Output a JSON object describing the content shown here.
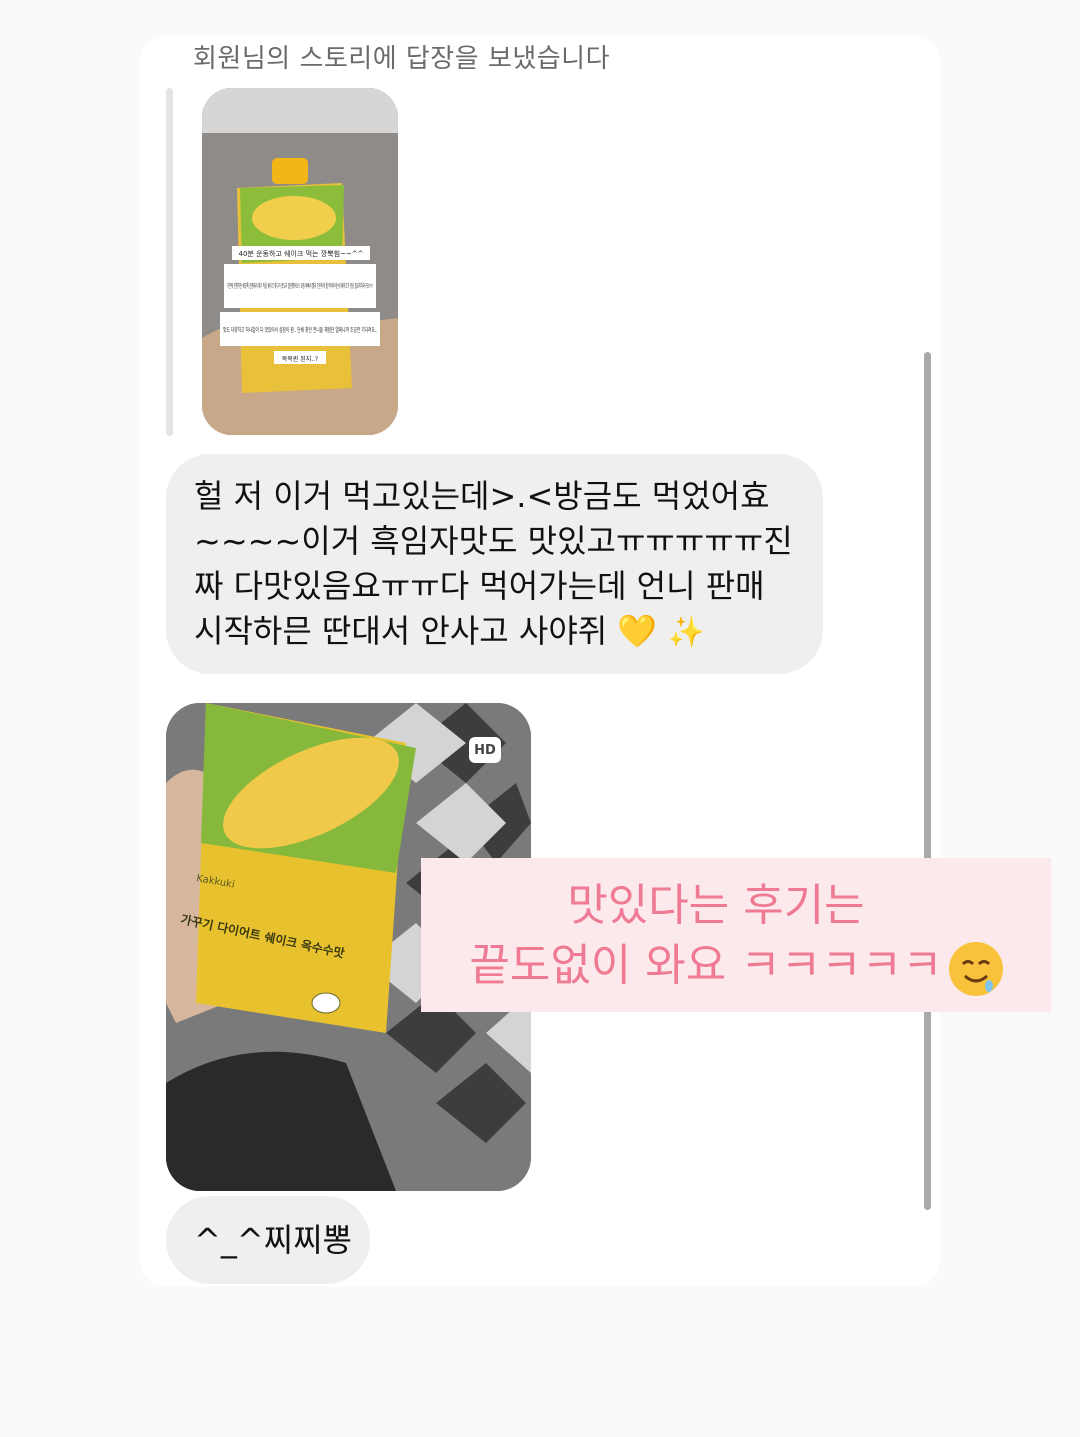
{
  "header": {
    "text": "회원님의 스토리에 답장을 보냈습니다"
  },
  "story_thumb": {
    "text_boxes": [
      "40분 운동하고 쉐이크 먹는 깡뿍힘~~^^",
      "기존에 진행하던 쉐잇톡 단종돼서 제가 먹을 쉐이크 찾다가 맛도리 발견했어요!! 요즘 바빠서 빨리 간단하게 뭘 먹어야되는데 쉐이크가 항상 필요하더라구요ㅠㅠ",
      "맛도 다양하고 하나같이 다 맛있어서 심장이 뭔.. 단쉐 찾던 언니들 체험단 열테니까 조금만 기다려요..",
      "목목퀸 된지..?"
    ]
  },
  "messages": {
    "main_text": "헐 저 이거 먹고있는데>.<방금도 먹었어효~~~~이거 흑임자맛도 맛있고ㅠㅠㅠㅠㅠ진짜 다맛있음요ㅠㅠ다 먹어가는데 언니 판매 시작하믄 딴대서 안사고 사야쥐",
    "heart_emoji": "💛",
    "sparkle_emoji": "✨",
    "small_text": "^_^찌찌뽕"
  },
  "photo": {
    "hd_label": "HD",
    "brand": "Kakkuki",
    "product_title": "가꾸기 다이어트 쉐이크 옥수수맛"
  },
  "caption": {
    "line1": "맛있다는 후기는",
    "line2": "끝도없이 와요 ㅋㅋㅋㅋㅋ"
  },
  "colors": {
    "bubble": "#efefef",
    "caption_bg": "#fce9ec",
    "caption_text": "#ef7a93",
    "scrollbar": "#a9a9a9"
  }
}
